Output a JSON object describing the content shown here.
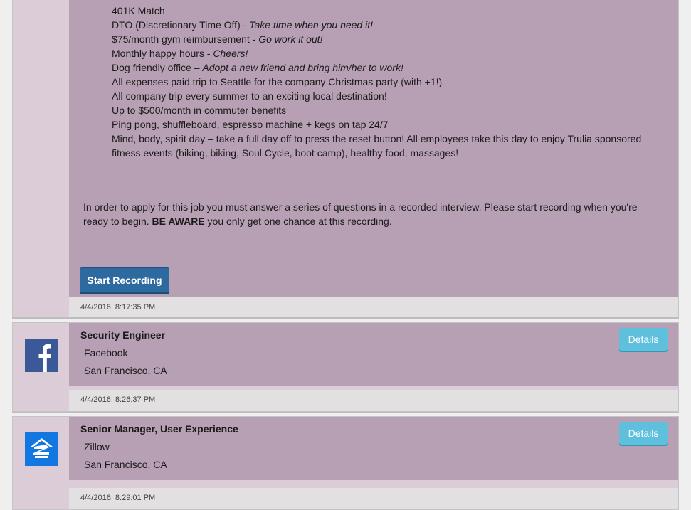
{
  "posting": {
    "perks": [
      {
        "text": "401K Match",
        "tagline": ""
      },
      {
        "text": "DTO (Discretionary Time Off) - ",
        "tagline": "Take time when you need it!"
      },
      {
        "text": "$75/month gym reimbursement - ",
        "tagline": "Go work it out!"
      },
      {
        "text": "Monthly happy hours - ",
        "tagline": "Cheers!"
      },
      {
        "text": "Dog friendly office – ",
        "tagline": "Adopt a new friend and bring him/her to work!"
      },
      {
        "text": "All expenses paid trip to Seattle for the company Christmas party (with +1!)",
        "tagline": ""
      },
      {
        "text": "All company trip every summer to an exciting local destination!",
        "tagline": ""
      },
      {
        "text": "Up to $500/month in commuter benefits",
        "tagline": ""
      },
      {
        "text": "Ping pong, shuffleboard, espresso machine + kegs on tap 24/7",
        "tagline": ""
      },
      {
        "text": "Mind, body, spirit day – take a full day off to press the reset button! All employees take this day to enjoy Trulia sponsored fitness events (hiking, biking, Soul Cycle, boot camp), healthy food, massages!",
        "tagline": ""
      }
    ],
    "apply_text_1": "In order to apply for this job you must answer a series of questions in a recorded interview. Please start recording when you're ready to begin. ",
    "apply_warning": "BE AWARE",
    "apply_text_2": " you only get one chance at this recording.",
    "start_recording_label": "Start Recording",
    "timestamp": "4/4/2016, 8:17:35 PM"
  },
  "jobs": [
    {
      "title": "Security Engineer",
      "company": "Facebook",
      "location": "San Francisco, CA",
      "details_label": "Details",
      "timestamp": "4/4/2016, 8:26:37 PM",
      "logo": "facebook-logo",
      "logo_color": "#3b5998"
    },
    {
      "title": "Senior Manager, User Experience",
      "company": "Zillow",
      "location": "San Francisco, CA",
      "details_label": "Details",
      "timestamp": "4/4/2016, 8:29:01 PM",
      "logo": "zillow-logo",
      "logo_color": "#1277e1"
    }
  ],
  "colors": {
    "card_content_bg": "#b7a0b3",
    "card_side_bg": "#dcccd8",
    "primary_button": "#2d6aa0",
    "info_button": "#5fc0de"
  }
}
